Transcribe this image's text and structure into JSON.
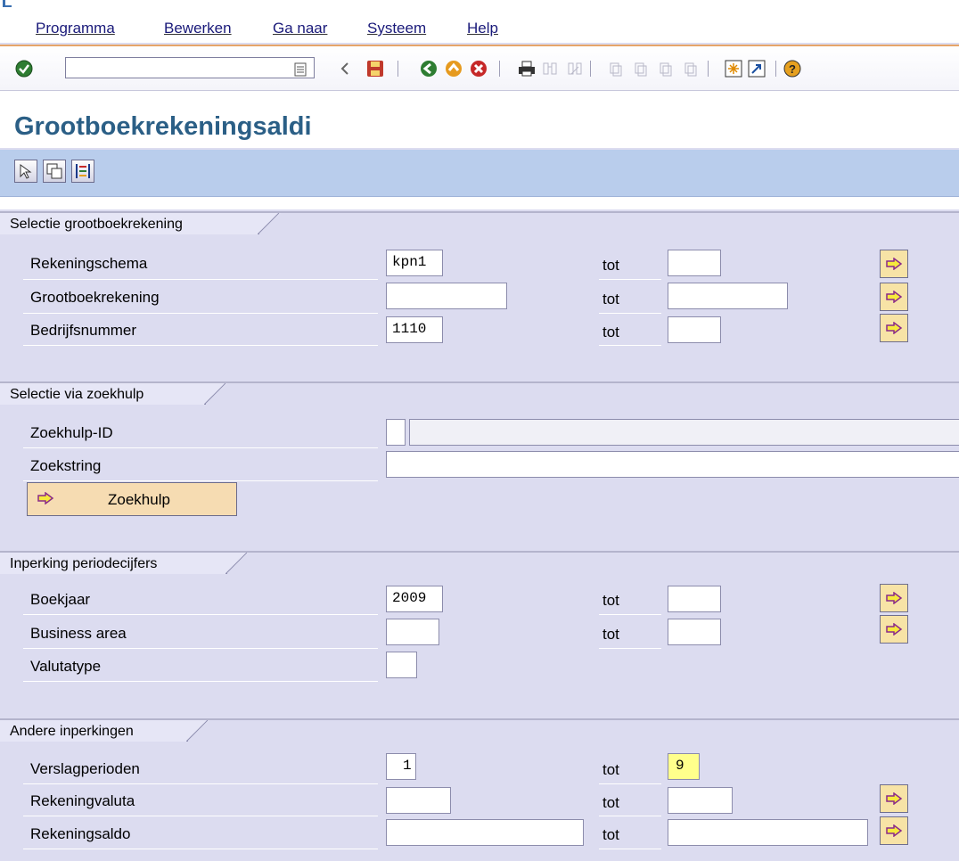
{
  "menu": {
    "items": [
      "Programma",
      "Bewerken",
      "Ga naar",
      "Systeem",
      "Help"
    ]
  },
  "toolbar": {
    "command_value": "",
    "icons": [
      "check-icon",
      "history-icon",
      "prev-arrow-icon",
      "save-icon",
      "back-icon",
      "exit-icon",
      "cancel-icon",
      "print-icon",
      "find-icon",
      "find-next-icon",
      "first-page-icon",
      "prev-page-icon",
      "next-page-icon",
      "last-page-icon",
      "new-session-icon",
      "shortcut-icon",
      "help-icon"
    ]
  },
  "page": {
    "title": "Grootboekrekeningsaldi"
  },
  "app_toolbar": {
    "icons": [
      "execute-icon",
      "variant-icon",
      "selection-options-icon"
    ]
  },
  "sections": {
    "selectie": {
      "title": "Selectie grootboekrekening",
      "rows": [
        {
          "label": "Rekeningschema",
          "value": "kpn1",
          "to_label": "tot",
          "to_value": ""
        },
        {
          "label": "Grootboekrekening",
          "value": "",
          "to_label": "tot",
          "to_value": ""
        },
        {
          "label": "Bedrijfsnummer",
          "value": "1110",
          "to_label": "tot",
          "to_value": ""
        }
      ]
    },
    "zoekhulp": {
      "title": "Selectie via zoekhulp",
      "rows": [
        {
          "label": "Zoekhulp-ID",
          "value": ""
        },
        {
          "label": "Zoekstring",
          "value": ""
        }
      ],
      "button_label": "Zoekhulp"
    },
    "inperking": {
      "title": "Inperking periodecijfers",
      "rows": [
        {
          "label": "Boekjaar",
          "value": "2009",
          "to_label": "tot",
          "to_value": ""
        },
        {
          "label": "Business area",
          "value": "",
          "to_label": "tot",
          "to_value": ""
        },
        {
          "label": "Valutatype",
          "value": ""
        }
      ]
    },
    "andere": {
      "title": "Andere inperkingen",
      "rows": [
        {
          "label": "Verslagperioden",
          "value": "1",
          "to_label": "tot",
          "to_value": "9"
        },
        {
          "label": "Rekeningvaluta",
          "value": "",
          "to_label": "tot",
          "to_value": ""
        },
        {
          "label": "Rekeningsaldo",
          "value": "",
          "to_label": "tot",
          "to_value": ""
        }
      ]
    }
  },
  "colors": {
    "title": "#2b5f86",
    "app_bar": "#b9cdec",
    "background": "#dcdcf0",
    "arrow_button": "#f7e3a6",
    "highlight": "#ffff8c"
  }
}
